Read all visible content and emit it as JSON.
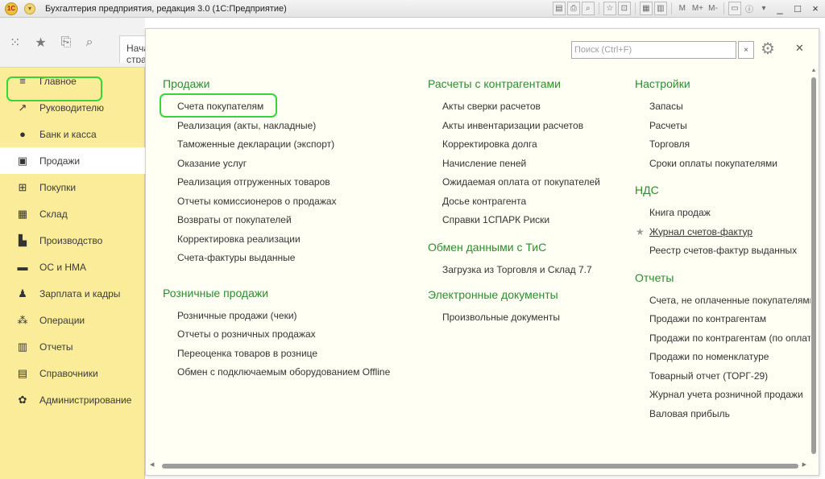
{
  "window": {
    "title": "Бухгалтерия предприятия, редакция 3.0  (1С:Предприятие)",
    "logo": "1С",
    "tools": [
      "M",
      "M+",
      "M-"
    ],
    "controls": [
      "_",
      "□",
      "×"
    ]
  },
  "toolbar": {
    "start_tab": "Начальная страница"
  },
  "sidebar": {
    "items": [
      {
        "label": "Главное",
        "icon": "≡"
      },
      {
        "label": "Руководителю",
        "icon": "↗"
      },
      {
        "label": "Банк и касса",
        "icon": "●"
      },
      {
        "label": "Продажи",
        "icon": "▣"
      },
      {
        "label": "Покупки",
        "icon": "⊞"
      },
      {
        "label": "Склад",
        "icon": "▦"
      },
      {
        "label": "Производство",
        "icon": "▙"
      },
      {
        "label": "ОС и НМА",
        "icon": "▬"
      },
      {
        "label": "Зарплата и кадры",
        "icon": "♟"
      },
      {
        "label": "Операции",
        "icon": "⁂"
      },
      {
        "label": "Отчеты",
        "icon": "▥"
      },
      {
        "label": "Справочники",
        "icon": "▤"
      },
      {
        "label": "Администрирование",
        "icon": "✿"
      }
    ]
  },
  "search": {
    "placeholder": "Поиск (Ctrl+F)"
  },
  "columns": {
    "col1": {
      "sections": [
        {
          "title": "Продажи",
          "links": [
            "Счета покупателям",
            "Реализация (акты, накладные)",
            "Таможенные декларации (экспорт)",
            "Оказание услуг",
            "Реализация отгруженных товаров",
            "Отчеты комиссионеров о продажах",
            "Возвраты от покупателей",
            "Корректировка реализации",
            "Счета-фактуры выданные"
          ]
        },
        {
          "title": "Розничные продажи",
          "links": [
            "Розничные продажи (чеки)",
            "Отчеты о розничных продажах",
            "Переоценка товаров в рознице",
            "Обмен с подключаемым оборудованием Offline"
          ]
        }
      ]
    },
    "col2": {
      "sections": [
        {
          "title": "Расчеты с контрагентами",
          "links": [
            "Акты сверки расчетов",
            "Акты инвентаризации расчетов",
            "Корректировка долга",
            "Начисление пеней",
            "Ожидаемая оплата от покупателей",
            "Досье контрагента",
            "Справки 1СПАРК Риски"
          ]
        },
        {
          "title": "Обмен данными с ТиС",
          "links": [
            "Загрузка из Торговля и Склад 7.7"
          ]
        },
        {
          "title": "Электронные документы",
          "links": [
            "Произвольные документы"
          ]
        }
      ]
    },
    "col3": {
      "sections": [
        {
          "title": "Настройки",
          "links": [
            "Запасы",
            "Расчеты",
            "Торговля",
            "Сроки оплаты покупателями"
          ]
        },
        {
          "title": "НДС",
          "links": [
            "Книга продаж",
            "Журнал счетов-фактур",
            "Реестр счетов-фактур выданных"
          ]
        },
        {
          "title": "Отчеты",
          "links": [
            "Счета, не оплаченные покупателями",
            "Продажи по контрагентам",
            "Продажи по контрагентам (по оплатам)",
            "Продажи по номенклатуре",
            "Товарный отчет (ТОРГ-29)",
            "Журнал учета розничной продажи",
            "Валовая прибыль"
          ]
        }
      ]
    }
  },
  "colors": {
    "accent_green": "#2d8c2d",
    "sidebar_bg": "#fbec9a",
    "highlight": "#3ad33a"
  }
}
